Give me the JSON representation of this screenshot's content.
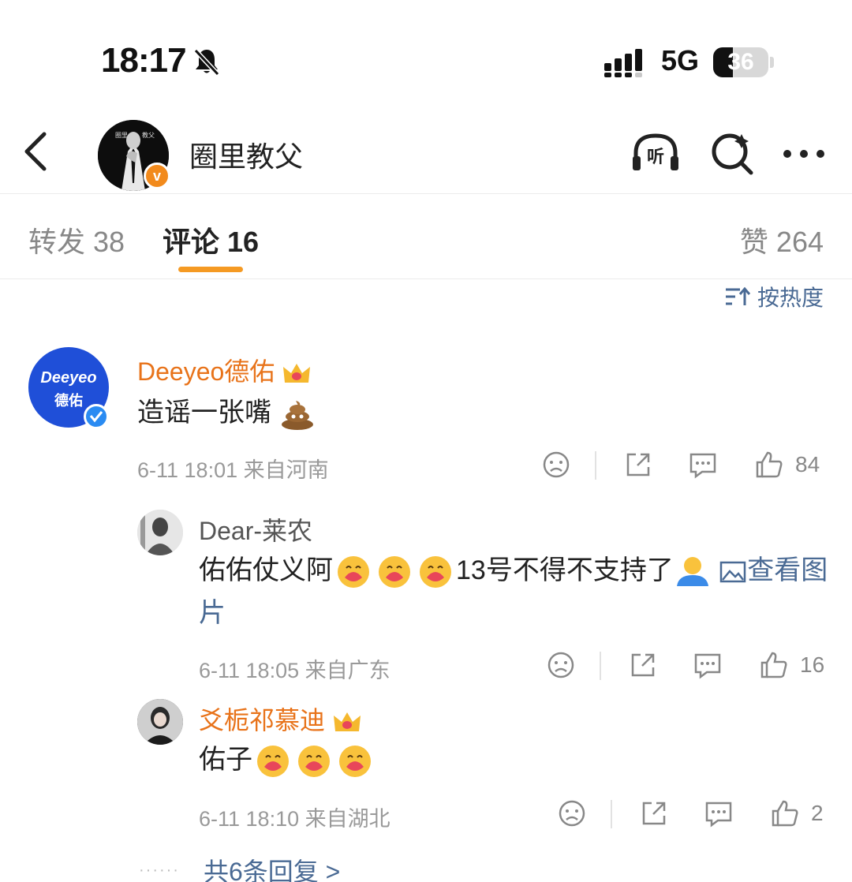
{
  "status": {
    "time": "18:17",
    "network": "5G",
    "battery": "36",
    "battery_level": 0.36
  },
  "nav": {
    "title": "圈里教父",
    "avatar_text_left": "圈里",
    "avatar_text_right": "教父",
    "badge": "v"
  },
  "tabs": [
    {
      "label": "转发 38"
    },
    {
      "label": "评论 16"
    },
    {
      "label": "赞 264"
    }
  ],
  "sort": {
    "label": "按热度"
  },
  "comments": [
    {
      "user": "Deeyeo德佑",
      "avatar_line1": "Deeyeo",
      "avatar_line2": "德佑",
      "text": "造谣一张嘴",
      "meta": "6-11 18:01  来自河南",
      "likes": "84"
    },
    {
      "user": "Dear-莱农",
      "text_a": "佑佑仗义阿",
      "text_b": "13号不得不支持了",
      "link": "查看图片",
      "meta": "6-11 18:05  来自广东",
      "likes": "16"
    },
    {
      "user": "爻栀祁慕迪",
      "text": "佑子",
      "meta": "6-11 18:10  来自湖北",
      "likes": "2"
    }
  ],
  "replies_link": "共6条回复 >",
  "colors": {
    "accent": "#f59a23",
    "link": "#4a6a94",
    "vip_name": "#e8731a",
    "verified": "#2a8bf2"
  }
}
